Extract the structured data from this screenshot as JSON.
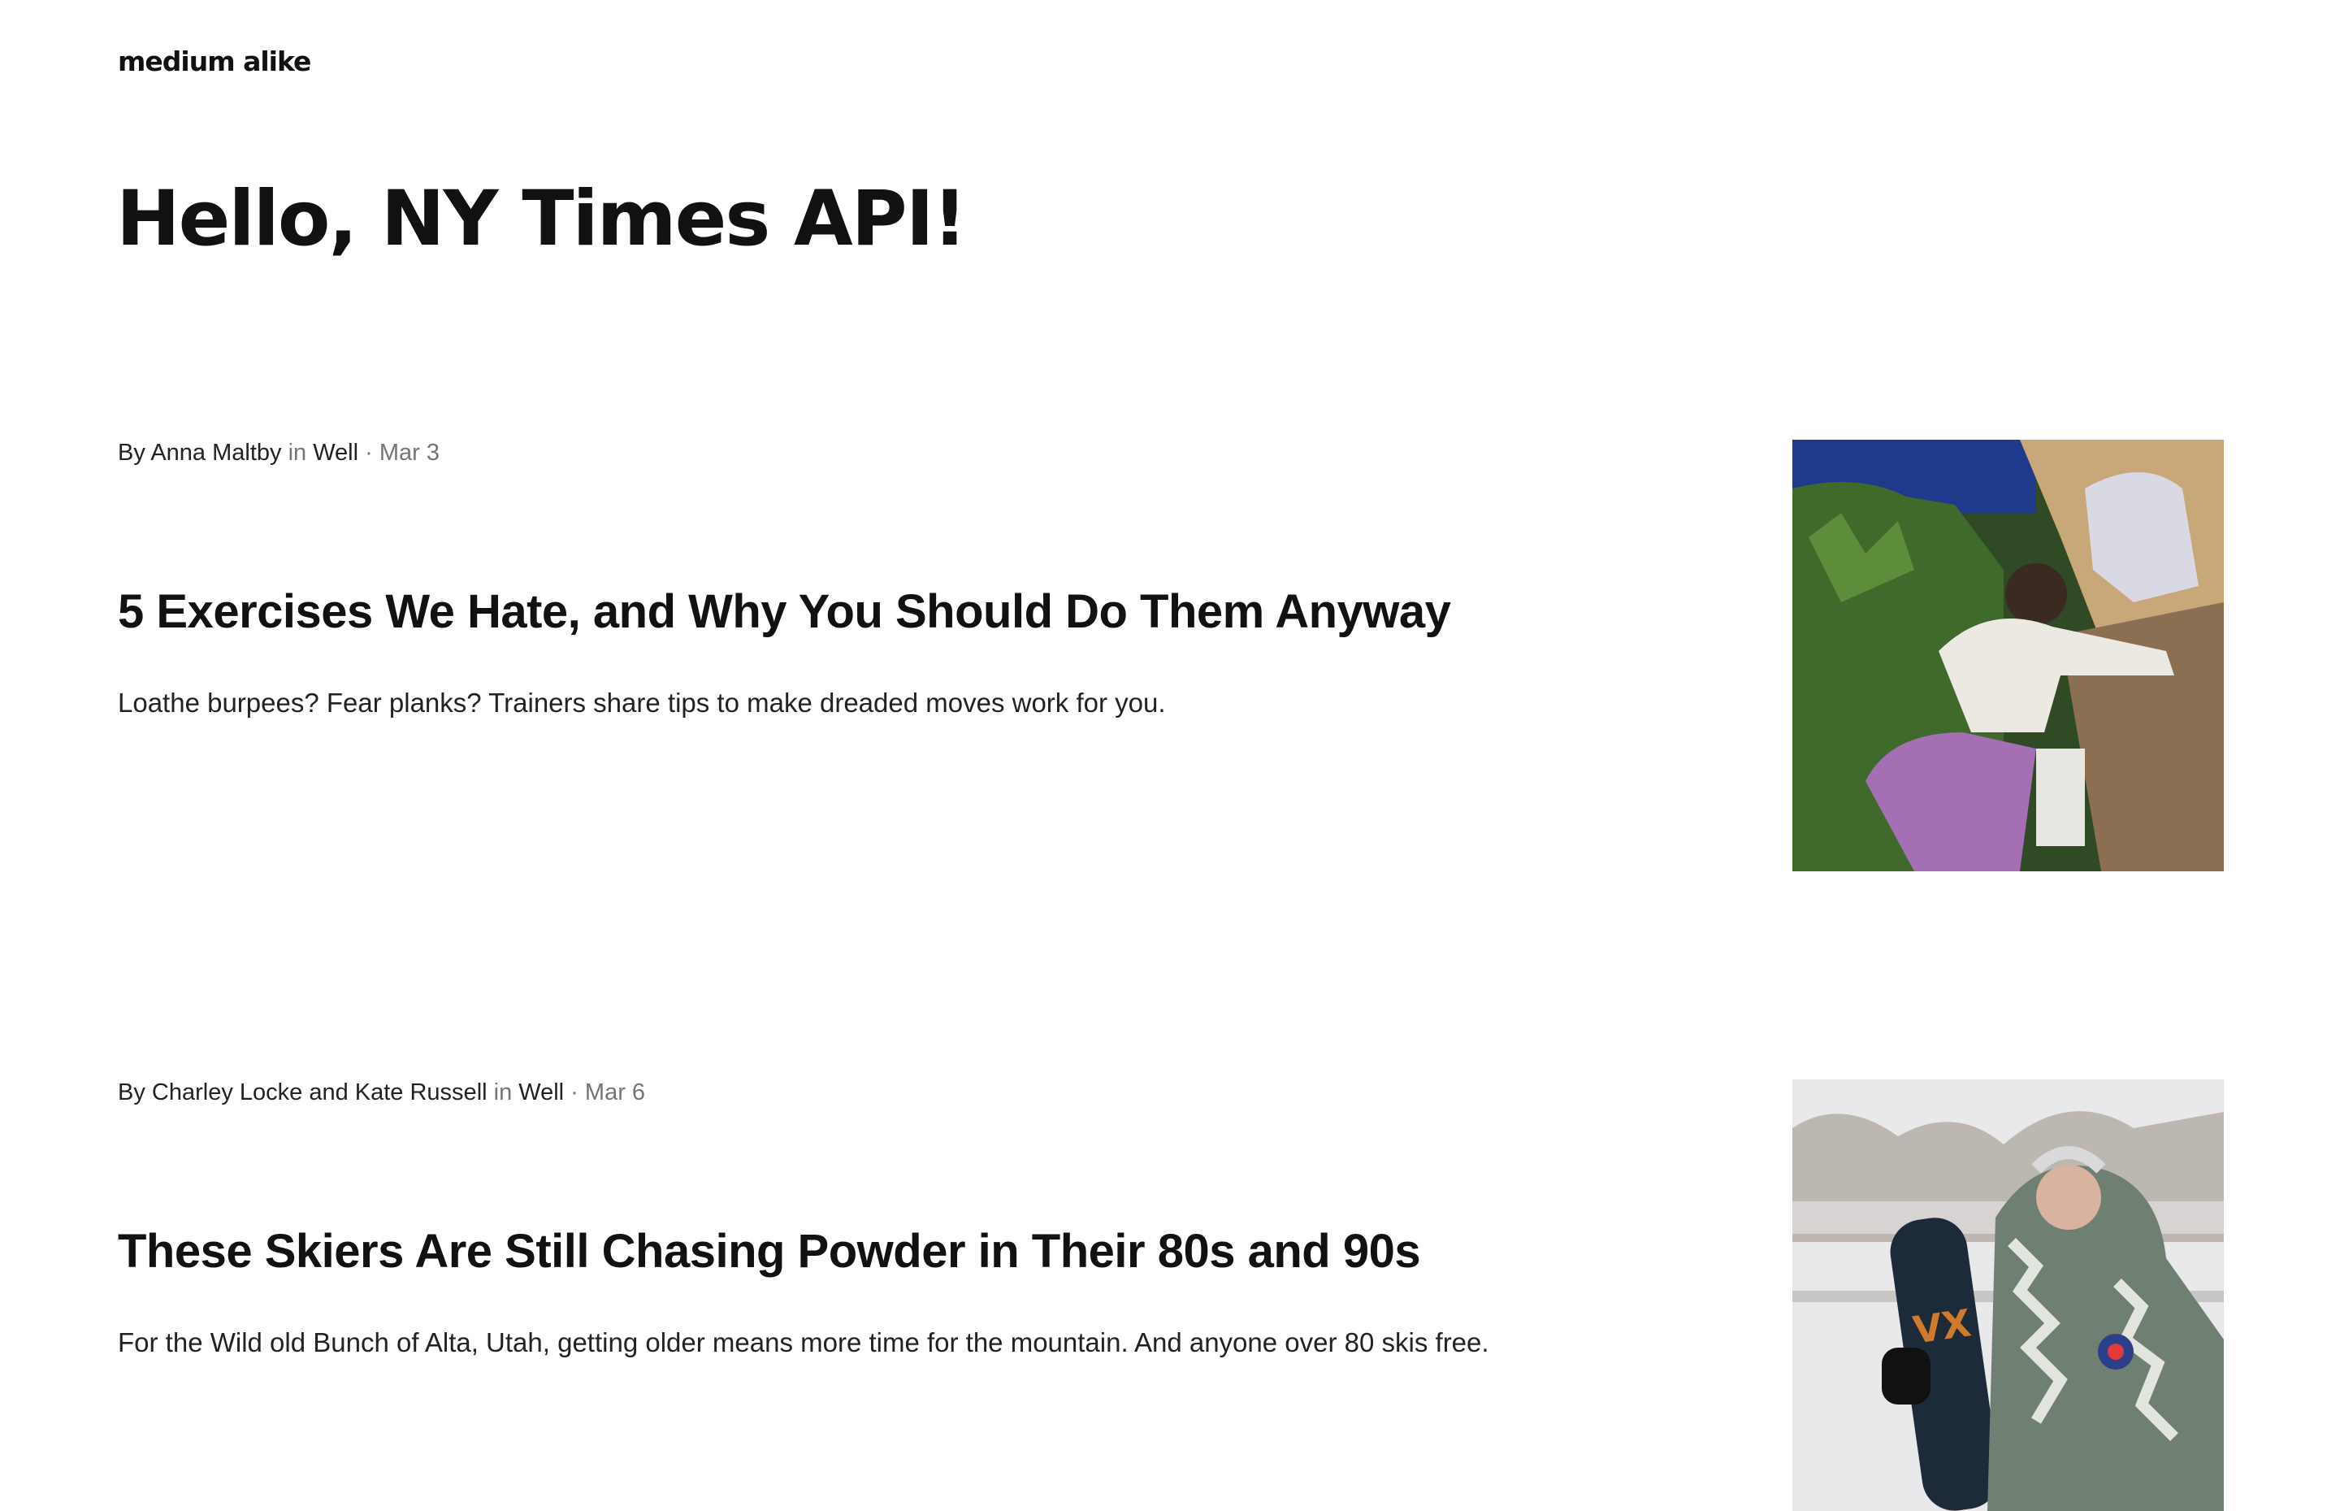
{
  "site": {
    "brand": "medium alike"
  },
  "page": {
    "title": "Hello, NY Times API!"
  },
  "articles": [
    {
      "by_prefix": "By ",
      "author": "Anna Maltby",
      "in_word": " in ",
      "section": "Well",
      "sep_date": " · Mar 3",
      "headline": "5 Exercises We Hate, and Why You Should Do Them Anyway",
      "summary": "Loathe burpees? Fear planks? Trainers share tips to make dreaded moves work for you.",
      "image_icon": "photo-thumbnail-exercise"
    },
    {
      "by_prefix": "By ",
      "author": "Charley Locke and Kate Russell",
      "in_word": " in ",
      "section": "Well",
      "sep_date": " · Mar 6",
      "headline": "These Skiers Are Still Chasing Powder in Their 80s and 90s",
      "summary": "For the Wild old Bunch of Alta, Utah, getting older means more time for the mountain. And anyone over 80 skis free.",
      "image_icon": "photo-thumbnail-skier"
    }
  ],
  "colors": {
    "text": "#111111",
    "muted": "#757575",
    "background": "#ffffff"
  }
}
